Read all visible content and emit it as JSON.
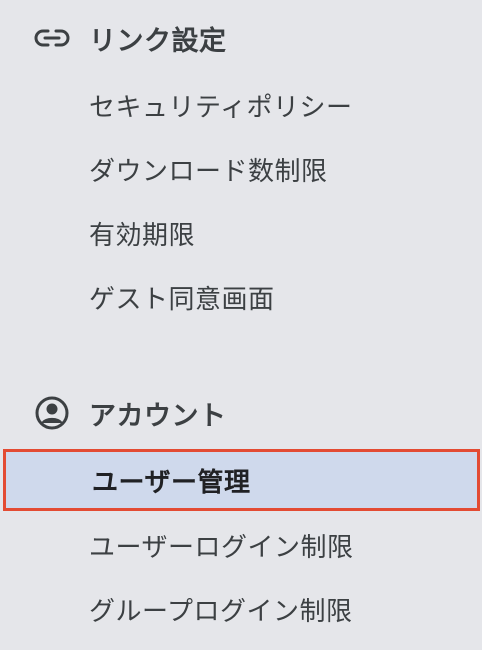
{
  "sidebar": {
    "sections": [
      {
        "title": "リンク設定",
        "icon": "link-icon",
        "items": [
          {
            "label": "セキュリティポリシー"
          },
          {
            "label": "ダウンロード数制限"
          },
          {
            "label": "有効期限"
          },
          {
            "label": "ゲスト同意画面"
          }
        ]
      },
      {
        "title": "アカウント",
        "icon": "account-circle-icon",
        "items": [
          {
            "label": "ユーザー管理",
            "selected": true
          },
          {
            "label": "ユーザーログイン制限"
          },
          {
            "label": "グループログイン制限"
          }
        ]
      }
    ],
    "colors": {
      "background": "#e5e6ea",
      "selected_background": "#cfd9ec",
      "selected_border": "#e34b33",
      "text": "#3c4043"
    }
  }
}
